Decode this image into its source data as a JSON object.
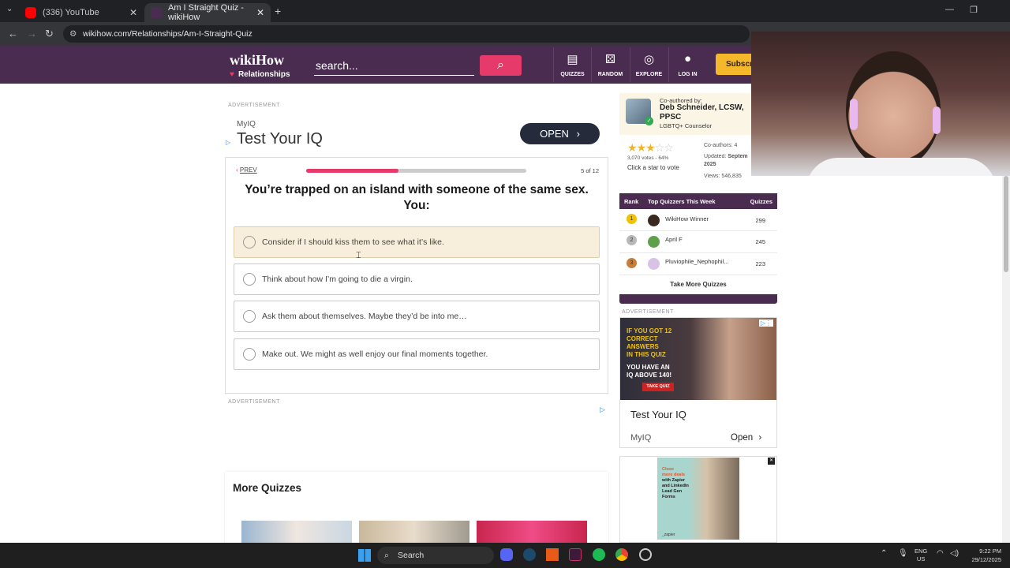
{
  "browser": {
    "tabs": [
      {
        "title": "(336) YouTube",
        "favicon_color": "#ff0000"
      },
      {
        "title": "Am I Straight Quiz - wikiHow",
        "favicon_color": "#4a2c50"
      }
    ],
    "url": "wikihow.com/Relationships/Am-I-Straight-Quiz"
  },
  "header": {
    "logo_main": "wikiHow",
    "logo_sub": "Relationships",
    "search_placeholder": "search...",
    "nav": [
      {
        "icon": "quizzes-icon",
        "glyph": "▤",
        "label": "QUIZZES"
      },
      {
        "icon": "dice-icon",
        "glyph": "⚄",
        "label": "RANDOM"
      },
      {
        "icon": "compass-icon",
        "glyph": "◎",
        "label": "EXPLORE"
      },
      {
        "icon": "user-icon",
        "glyph": "●",
        "label": "LOG IN"
      }
    ],
    "subscribe": "Subscr"
  },
  "ad_top": {
    "label": "ADVERTISEMENT",
    "brand": "MyIQ",
    "title": "Test Your IQ",
    "button": "OPEN"
  },
  "quiz": {
    "prev": "PREV",
    "progress": 0.42,
    "counter": "5 of 12",
    "question": "You’re trapped on an island with someone of the same sex. You:",
    "options": [
      "Consider if I should kiss them to see what it’s like.",
      "Think about how I’m going to die a virgin.",
      "Ask them about themselves. Maybe they’d be into me…",
      "Make out. We might as well enjoy our final moments together."
    ]
  },
  "ad_bottom_label": "ADVERTISEMENT",
  "more_quizzes": {
    "title": "More Quizzes"
  },
  "sidebar": {
    "author": {
      "coauthored_label": "Co-authored by:",
      "name": "Deb Schneider, LCSW, PPSC",
      "role": "LGBTQ+ Counselor"
    },
    "stats": {
      "rating": 3,
      "votes": "3,070 votes - 64%",
      "vote_prompt": "Click a star to vote",
      "coauthors": "Co-authors: 4",
      "updated_label": "Updated:",
      "updated_value": "Septem",
      "updated_year": "2025",
      "views": "Views: 546,835"
    },
    "leaderboard": {
      "col_rank": "Rank",
      "col_title": "Top Quizzers This Week",
      "col_quizzes": "Quizzes",
      "rows": [
        {
          "rank": "1",
          "name": "WikiHow Winner",
          "score": "299",
          "medal_color": "#f2c200"
        },
        {
          "rank": "2",
          "name": "April F",
          "score": "245",
          "medal_color": "#b8b8b8"
        },
        {
          "rank": "3",
          "name": "Pluviophile_Nephophil...",
          "score": "223",
          "medal_color": "#c87d3a"
        }
      ],
      "more": "Take More Quizzes"
    },
    "ad_label": "ADVERTISEMENT",
    "ad1": {
      "banner_lines": [
        "IF YOU GOT 12",
        "CORRECT ANSWERS",
        "IN THIS QUIZ",
        "YOU HAVE AN",
        "IQ ABOVE 140!"
      ],
      "banner_button": "TAKE QUIZ",
      "title": "Test Your IQ",
      "brand": "MyIQ",
      "open": "Open"
    },
    "ad2": {
      "lines": [
        "Close",
        "more deals",
        "with Zapier",
        "and LinkedIn",
        "Lead Gen",
        "Forms"
      ],
      "footer": "_zapier"
    }
  },
  "taskbar": {
    "search": "Search",
    "lang1": "ENG",
    "lang2": "US",
    "time": "9:22 PM",
    "date": "29/12/2025"
  }
}
